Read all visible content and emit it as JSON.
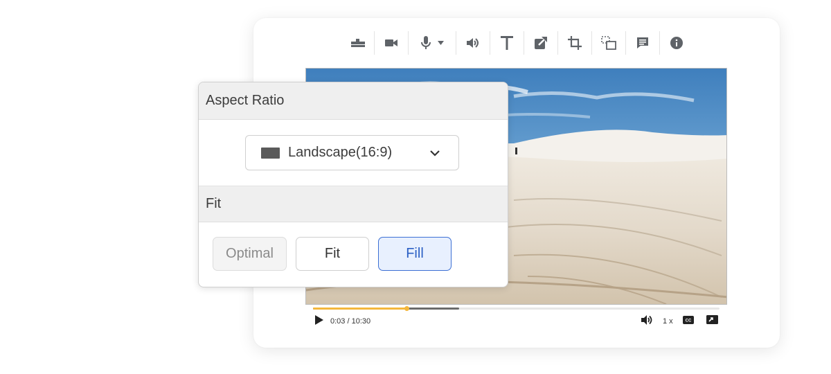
{
  "toolbar": {
    "tools": [
      "timeline-icon",
      "camera-icon",
      "microphone-icon",
      "speaker-icon",
      "text-icon",
      "export-icon",
      "crop-icon",
      "resize-icon",
      "comment-icon",
      "info-icon"
    ]
  },
  "player": {
    "time": "0:03 / 10:30",
    "speed": "1 x",
    "played_fraction": 0.23,
    "buffered_fraction": 0.36
  },
  "panel": {
    "aspect_title": "Aspect Ratio",
    "aspect_value": "Landscape(16:9)",
    "fit_title": "Fit",
    "options": {
      "optimal": "Optimal",
      "fit": "Fit",
      "fill": "Fill"
    },
    "selected": "Fill"
  },
  "colors": {
    "accent": "#3b6fd4",
    "progress": "#f4b73b",
    "selected_bg": "#e8f0fe"
  }
}
